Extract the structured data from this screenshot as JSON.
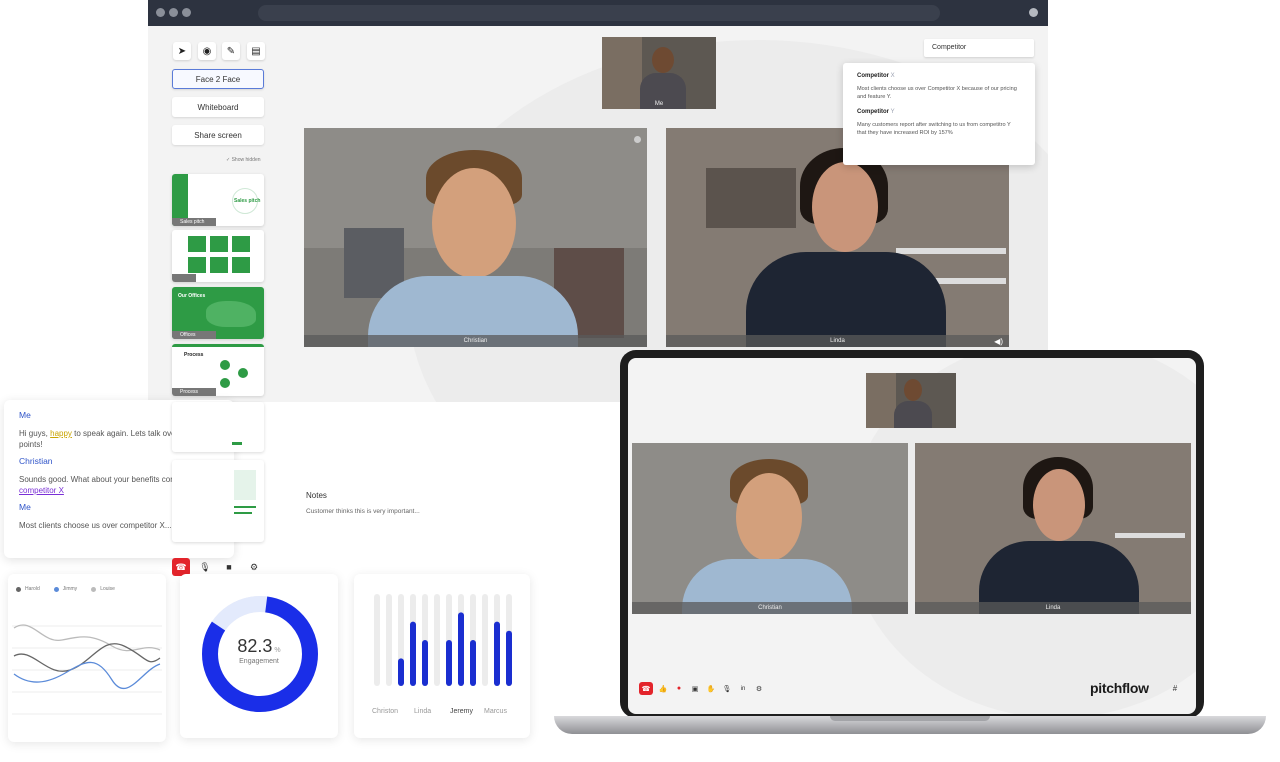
{
  "browser": {
    "tools": [
      "pointer-icon",
      "broadcast-icon",
      "pen-icon",
      "file-icon"
    ],
    "modes": [
      {
        "label": "Face 2 Face",
        "active": true
      },
      {
        "label": "Whiteboard",
        "active": false
      },
      {
        "label": "Share screen",
        "active": false
      }
    ],
    "show_hidden": "Show hidden",
    "slides": [
      {
        "label": "Sales pitch",
        "title": "Sales pitch"
      },
      {
        "label": ""
      },
      {
        "label": "Offices",
        "title": "Our Offices"
      },
      {
        "label": "Process",
        "title": "Process"
      }
    ],
    "self_label": "Me",
    "videos": [
      {
        "name": "Christian"
      },
      {
        "name": "Linda"
      }
    ],
    "competitor_input": "Competitor",
    "competitors": [
      {
        "title": "Competitor",
        "letter": "X",
        "text": "Most clients choose us over Competitor X because of our pricing and feature Y."
      },
      {
        "title": "Competitor",
        "letter": "Y",
        "text": "Many customers report after switching to us from competitro Y that they have increased ROI by 157%"
      }
    ]
  },
  "chat": {
    "messages": [
      {
        "sender": "Me",
        "pre": "Hi guys, ",
        "highlight": "happy",
        "post": " to speak again. Lets talk over the latest points!"
      },
      {
        "sender": "Christian",
        "pre": "Sounds good. What about your benefits compared to ",
        "link": "competitor X"
      },
      {
        "sender": "Me",
        "text": "Most clients choose us over competitor X....."
      }
    ]
  },
  "notes": {
    "title": "Notes",
    "text": "Customer thinks this is very important..."
  },
  "line_chart": {
    "legend": [
      {
        "name": "Harold",
        "color": "#666666"
      },
      {
        "name": "Jimmy",
        "color": "#5b8bd9"
      },
      {
        "name": "Louise",
        "color": "#bbbbbb"
      }
    ]
  },
  "engagement": {
    "value": "82.3",
    "unit": "%",
    "label": "Engagement",
    "fraction": 0.823
  },
  "bars": {
    "names": [
      "Christon",
      "Linda",
      "Jeremy",
      "Marcus"
    ],
    "values": [
      0,
      0,
      0.3,
      0.7,
      0.5,
      0,
      0.5,
      0.8,
      0.5,
      0,
      0.7,
      0.6
    ]
  },
  "laptop": {
    "videos": [
      {
        "name": "Christian"
      },
      {
        "name": "Linda"
      }
    ],
    "brand": "pitchflow"
  }
}
